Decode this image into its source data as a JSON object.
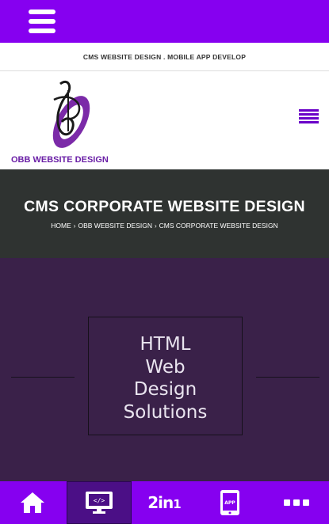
{
  "topbar": {
    "menu_icon": "hamburger-icon",
    "color": "#8600f0"
  },
  "tagline": "CMS WEBSITE DESIGN . MOBILE APP DEVELOP",
  "header": {
    "logo_text": "OBB WEBSITE DESIGN",
    "logo_icon": "obb-logo",
    "menu_icon": "menu-icon"
  },
  "title_band": {
    "title": "CMS CORPORATE WEBSITE DESIGN",
    "breadcrumb": [
      "HOME",
      "OBB WEBSITE DESIGN",
      "CMS CORPORATE WEBSITE DESIGN"
    ],
    "separator": "›"
  },
  "hero": {
    "lines": [
      "HTML",
      "Web",
      "Design",
      "Solutions"
    ],
    "background": "#3a2149"
  },
  "bottom_nav": {
    "items": [
      {
        "name": "home",
        "icon": "home-icon"
      },
      {
        "name": "web-design",
        "icon": "code-monitor-icon",
        "active": true
      },
      {
        "name": "two-in-one",
        "label_main": "2in",
        "label_sub": "1"
      },
      {
        "name": "app",
        "icon": "tablet-app-icon",
        "icon_text": "APP"
      },
      {
        "name": "more",
        "icon": "more-icon"
      }
    ],
    "color": "#8600f0",
    "active_color": "#4b0f86"
  }
}
